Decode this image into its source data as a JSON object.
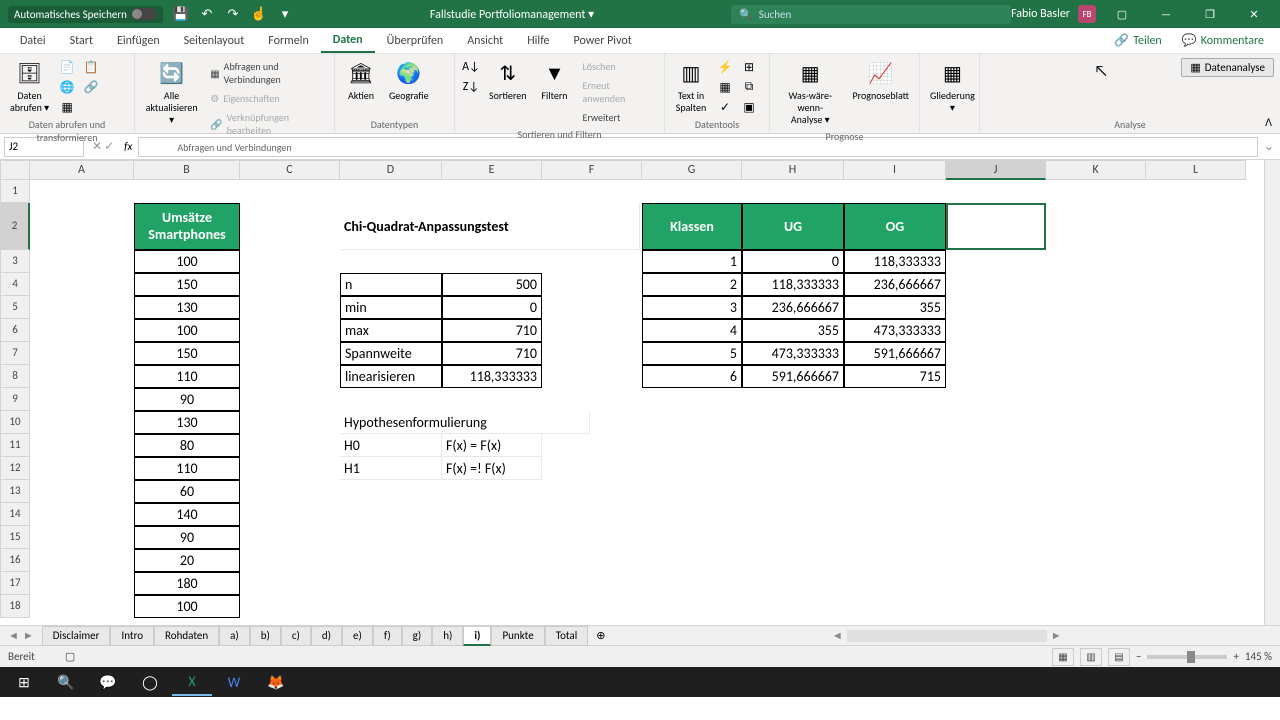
{
  "titlebar": {
    "autosave": "Automatisches Speichern",
    "doc_title": "Fallstudie Portfoliomanagement ▾",
    "search_placeholder": "Suchen",
    "user_name": "Fabio Basler",
    "user_initials": "FB"
  },
  "tabs": {
    "datei": "Datei",
    "start": "Start",
    "einfuegen": "Einfügen",
    "seitenlayout": "Seitenlayout",
    "formeln": "Formeln",
    "daten": "Daten",
    "ueberpruefen": "Überprüfen",
    "ansicht": "Ansicht",
    "hilfe": "Hilfe",
    "powerpivot": "Power Pivot",
    "teilen": "Teilen",
    "kommentare": "Kommentare"
  },
  "ribbon": {
    "daten_abrufen": "Daten\nabrufen ▾",
    "grp1": "Daten abrufen und transformieren",
    "alle_akt": "Alle\naktualisieren ▾",
    "abfragen": "Abfragen und Verbindungen",
    "eigenschaften": "Eigenschaften",
    "verknuepfungen": "Verknüpfungen bearbeiten",
    "grp2": "Abfragen und Verbindungen",
    "aktien": "Aktien",
    "geografie": "Geografie",
    "grp3": "Datentypen",
    "sortieren": "Sortieren",
    "filtern": "Filtern",
    "loeschen": "Löschen",
    "erneut": "Erneut anwenden",
    "erweitert": "Erweitert",
    "grp4": "Sortieren und Filtern",
    "text_spalten": "Text in\nSpalten",
    "grp5": "Datentools",
    "was_waere": "Was-wäre-wenn-\nAnalyse ▾",
    "prognoseblatt": "Prognoseblatt",
    "grp6": "Prognose",
    "gliederung": "Gliederung\n▾",
    "grp7": "Analyse",
    "datenanalyse": "Datenanalyse"
  },
  "formula": {
    "cell_ref": "J2"
  },
  "columns": [
    "A",
    "B",
    "C",
    "D",
    "E",
    "F",
    "G",
    "H",
    "I",
    "J",
    "K",
    "L"
  ],
  "rows": [
    "1",
    "2",
    "3",
    "4",
    "5",
    "6",
    "7",
    "8",
    "9",
    "10",
    "11",
    "12",
    "13",
    "14",
    "15",
    "16",
    "17",
    "18"
  ],
  "cells": {
    "B2": "Umsätze Smartphones",
    "B3": "100",
    "B4": "150",
    "B5": "130",
    "B6": "100",
    "B7": "150",
    "B8": "110",
    "B9": "90",
    "B10": "130",
    "B11": "80",
    "B12": "110",
    "B13": "60",
    "B14": "140",
    "B15": "90",
    "B16": "20",
    "B17": "180",
    "B18": "100",
    "D2": "Chi-Quadrat-Anpassungstest",
    "D4": "n",
    "E4": "500",
    "D5": "min",
    "E5": "0",
    "D6": "max",
    "E6": "710",
    "D7": "Spannweite",
    "E7": "710",
    "D8": "linearisieren",
    "E8": "118,333333",
    "D10": "Hypothesenformulierung",
    "D11": "H0",
    "E11": "F(x) = F(x)",
    "D12": "H1",
    "E12": "F(x) =! F(x)",
    "G2": "Klassen",
    "H2": "UG",
    "I2": "OG",
    "G3": "1",
    "H3": "0",
    "I3": "118,333333",
    "G4": "2",
    "H4": "118,333333",
    "I4": "236,666667",
    "G5": "3",
    "H5": "236,666667",
    "I5": "355",
    "G6": "4",
    "H6": "355",
    "I6": "473,333333",
    "G7": "5",
    "H7": "473,333333",
    "I7": "591,666667",
    "G8": "6",
    "H8": "591,666667",
    "I8": "715"
  },
  "sheets": [
    "Disclaimer",
    "Intro",
    "Rohdaten",
    "a)",
    "b)",
    "c)",
    "d)",
    "e)",
    "f)",
    "g)",
    "h)",
    "i)",
    "Punkte",
    "Total"
  ],
  "active_sheet": "i)",
  "status": {
    "ready": "Bereit",
    "zoom": "145 %"
  }
}
